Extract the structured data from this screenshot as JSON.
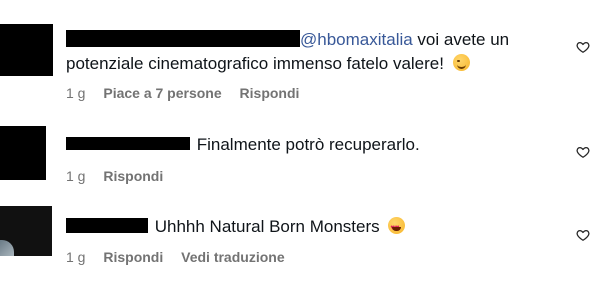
{
  "comments": [
    {
      "mention": "@hbomaxitalia",
      "text_line1": " voi avete un",
      "text_line2": "potenziale cinematografico immenso fatelo valere! ",
      "emoji": "wink-smile",
      "time": "1 g",
      "likes_label": "Piace a 7 persone",
      "reply_label": "Rispondi"
    },
    {
      "text": "Finalmente potrò recuperarlo.",
      "time": "1 g",
      "reply_label": "Rispondi"
    },
    {
      "text": "Uhhhh Natural Born Monsters ",
      "emoji": "heart-eyes",
      "time": "1 g",
      "reply_label": "Rispondi",
      "translate_label": "Vedi traduzione"
    }
  ],
  "icons": {
    "like": "heart-outline-icon"
  },
  "colors": {
    "mention": "#385898",
    "meta": "#737373",
    "text": "#0f1419"
  }
}
